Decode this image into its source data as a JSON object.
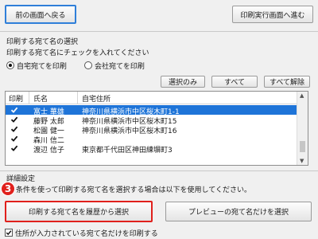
{
  "nav": {
    "back_label": "前の画面へ戻る",
    "next_label": "印刷実行画面へ進む"
  },
  "selection": {
    "title": "印刷する宛て名の選択",
    "instruction": "印刷する宛て名にチェックを入れてください",
    "radio_home": "自宅宛てを印刷",
    "radio_company": "会社宛てを印刷",
    "selected_radio": "自宅宛てを印刷",
    "select_only_label": "選択のみ",
    "all_label": "すべて",
    "clear_all_label": "すべて解除"
  },
  "list": {
    "columns": [
      "印刷",
      "氏名",
      "自宅住所"
    ],
    "rows": [
      {
        "checked": true,
        "name": "富士 華雄",
        "address": "神奈川県横浜市中区桜木町1-1",
        "selected": true
      },
      {
        "checked": true,
        "name": "藤野 太郎",
        "address": "神奈川県横浜市中区桜木町15",
        "selected": false
      },
      {
        "checked": true,
        "name": "松園 健一",
        "address": "神奈川県横浜市中区桜木町16",
        "selected": false
      },
      {
        "checked": true,
        "name": "森川 信二",
        "address": "",
        "selected": false
      },
      {
        "checked": true,
        "name": "渡辺 信子",
        "address": "東京都千代田区神田練塀町3",
        "selected": false
      }
    ]
  },
  "details": {
    "title": "詳細設定",
    "note": "条件を使って印刷する宛て名を選択する場合は以下を使用してください。",
    "step_number": "3",
    "history_button": "印刷する宛て名を履歴から選択",
    "preview_button": "プレビューの宛て名だけを選択",
    "address_only_label": "住所が入力されている宛て名だけを印刷する",
    "address_only_checked": true
  },
  "colors": {
    "selection": "#1e74d8",
    "highlight_red": "#e0201c",
    "focus_blue": "#2f7fd9"
  }
}
